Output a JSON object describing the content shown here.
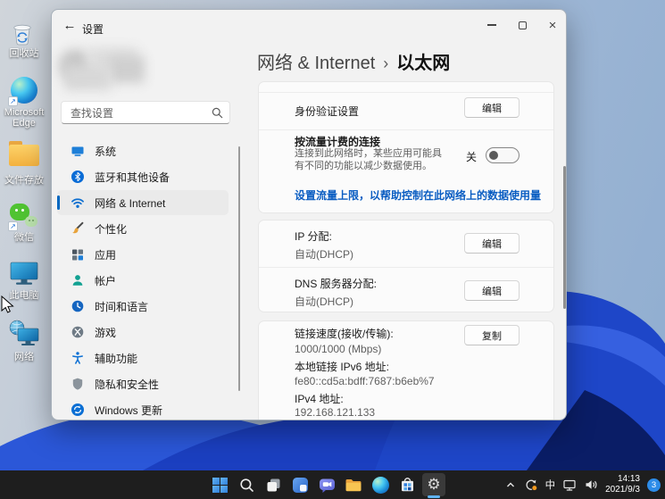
{
  "window": {
    "title": "设置",
    "back_glyph": "←",
    "close_glyph": "×"
  },
  "sidebar": {
    "search_placeholder": "查找设置",
    "items": [
      {
        "label": "系统",
        "icon": "system-icon"
      },
      {
        "label": "蓝牙和其他设备",
        "icon": "bluetooth-icon"
      },
      {
        "label": "网络 & Internet",
        "icon": "network-internet-icon",
        "selected": true
      },
      {
        "label": "个性化",
        "icon": "personalization-icon"
      },
      {
        "label": "应用",
        "icon": "apps-icon"
      },
      {
        "label": "帐户",
        "icon": "accounts-icon"
      },
      {
        "label": "时间和语言",
        "icon": "time-language-icon"
      },
      {
        "label": "游戏",
        "icon": "gaming-icon"
      },
      {
        "label": "辅助功能",
        "icon": "accessibility-icon"
      },
      {
        "label": "隐私和安全性",
        "icon": "privacy-security-icon"
      },
      {
        "label": "Windows 更新",
        "icon": "windows-update-icon"
      }
    ]
  },
  "main": {
    "breadcrumb": {
      "parent": "网络 & Internet",
      "separator": "›",
      "current": "以太网"
    },
    "auth": {
      "label": "身份验证设置",
      "button": "编辑"
    },
    "metered": {
      "title": "按流量计费的连接",
      "description": "连接到此网络时，某些应用可能具有不同的功能以减少数据使用。",
      "toggle_label": "关",
      "toggle_state": "off"
    },
    "data_limit_link": "设置流量上限，以帮助控制在此网络上的数据使用量",
    "ip": {
      "label": "IP 分配:",
      "value": "自动(DHCP)",
      "button": "编辑"
    },
    "dns": {
      "label": "DNS 服务器分配:",
      "value": "自动(DHCP)",
      "button": "编辑"
    },
    "link_speed": {
      "label": "链接速度(接收/传输):",
      "value": "1000/1000 (Mbps)",
      "button": "复制"
    },
    "ipv6": {
      "label": "本地链接 IPv6 地址:",
      "value": "fe80::cd5a:bdff:7687:b6eb%7"
    },
    "ipv4": {
      "label": "IPv4 地址:",
      "value": "192.168.121.133"
    }
  },
  "desktop": {
    "icons": [
      {
        "label": "回收站",
        "icon": "recycle-bin-icon"
      },
      {
        "label": "Microsoft Edge",
        "icon": "edge-icon"
      },
      {
        "label": "文件存放",
        "icon": "folder-icon"
      },
      {
        "label": "微信",
        "icon": "wechat-icon"
      },
      {
        "label": "此电脑",
        "icon": "this-pc-icon"
      },
      {
        "label": "网络",
        "icon": "network-places-icon"
      }
    ]
  },
  "taskbar": {
    "icons": [
      "start-icon",
      "search-icon",
      "task-view-icon",
      "widgets-icon",
      "chat-icon",
      "file-explorer-icon",
      "edge-icon",
      "store-icon",
      "settings-icon"
    ],
    "active_app": "settings"
  },
  "tray": {
    "ime": "中",
    "time": "14:13",
    "date": "2021/9/3",
    "badge_count": "3"
  },
  "colors": {
    "accent": "#0067c0",
    "link": "#0a5dc2",
    "taskbar_bg": "#1e1e1e",
    "window_bg": "#f2f2f2",
    "card_bg": "#fbfbfb",
    "badge": "#2d8ce8",
    "bloom_blue": "#1e46c8",
    "bloom_dark": "#0a1d66"
  }
}
